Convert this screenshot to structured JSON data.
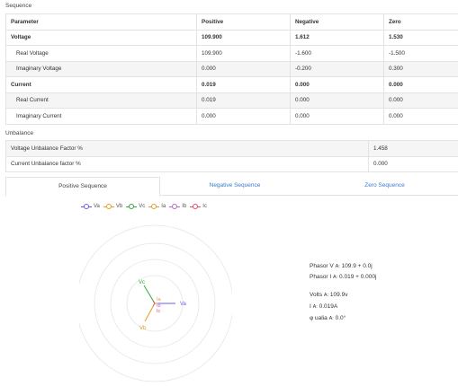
{
  "sequence": {
    "title": "Sequence",
    "headers": [
      "Parameter",
      "Positive",
      "Negative",
      "Zero"
    ],
    "rows": [
      {
        "param": "Voltage",
        "positive": "109.900",
        "negative": "1.612",
        "zero": "1.530"
      },
      {
        "param": "Real Voltage",
        "positive": "109.900",
        "negative": "-1.600",
        "zero": "-1.500"
      },
      {
        "param": "Imaginary Voltage",
        "positive": "0.000",
        "negative": "-0.200",
        "zero": "0.300"
      },
      {
        "param": "Current",
        "positive": "0.019",
        "negative": "0.000",
        "zero": "0.000"
      },
      {
        "param": "Real Current",
        "positive": "0.019",
        "negative": "0.000",
        "zero": "0.000"
      },
      {
        "param": "Imaginary Current",
        "positive": "0.000",
        "negative": "0.000",
        "zero": "0.000"
      }
    ]
  },
  "unbalance": {
    "title": "Unbalance",
    "rows": [
      {
        "label": "Voltage Unbalance Factor",
        "unit": "%",
        "value": "1.458"
      },
      {
        "label": "Current Unbalance factor",
        "unit": "%",
        "value": "0.000"
      }
    ]
  },
  "tabs": [
    {
      "label": "Positive Sequence",
      "active": true
    },
    {
      "label": "Negative Sequence",
      "active": false
    },
    {
      "label": "Zero Sequence",
      "active": false
    }
  ],
  "legend": [
    {
      "label": "Va",
      "color": "#6a5cf0"
    },
    {
      "label": "Vb",
      "color": "#e3a020"
    },
    {
      "label": "Vc",
      "color": "#33aa33"
    },
    {
      "label": "Ia",
      "color": "#e39a3a"
    },
    {
      "label": "Ib",
      "color": "#c45fd6"
    },
    {
      "label": "Ic",
      "color": "#e84c6a"
    }
  ],
  "phasor_labels": {
    "va": "Va",
    "vb": "Vb",
    "vc": "Vc",
    "ia": "Ia",
    "ib": "Ib",
    "ic": "Ic"
  },
  "info": {
    "phasor_v_label": "Phasor V",
    "phasor_v_unit": "A:",
    "phasor_v_value": "109.9 + 0.0j",
    "phasor_i_label": "Phasor I",
    "phasor_i_unit": "A:",
    "phasor_i_value": "0.019 + 0.000j",
    "volts_label": "Volts",
    "volts_unit": "A:",
    "volts_value": "109.9v",
    "i_label": "I",
    "i_unit": "A:",
    "i_value": "0.019A",
    "phi_label": "φ ualia",
    "phi_unit": "A:",
    "phi_value": "0.0°"
  }
}
